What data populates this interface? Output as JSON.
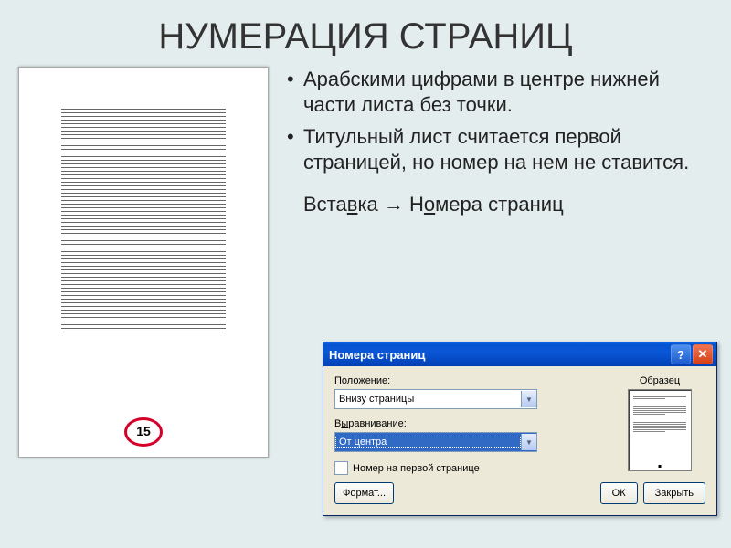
{
  "title": "НУМЕРАЦИЯ СТРАНИЦ",
  "bullets": [
    "Арабскими цифрами в центре нижней части листа без точки.",
    "Титульный лист считается первой страницей, но номер на нем не ставится."
  ],
  "menu_path": {
    "part1": "Вста",
    "u1": "в",
    "part2": "ка",
    "arrow": "→",
    "part3": "Н",
    "u2": "о",
    "part4": "мера страниц"
  },
  "page_sample": {
    "number": "15"
  },
  "dialog": {
    "title": "Номера страниц",
    "position_label_pre": "П",
    "position_label_u": "о",
    "position_label_post": "ложение:",
    "position_value": "Внизу страницы",
    "align_label_pre": "В",
    "align_label_u": "ы",
    "align_label_post": "равнивание:",
    "align_value": "От центра",
    "sample_label_pre": "Образе",
    "sample_label_u": "ц",
    "checkbox_pre": "",
    "checkbox_u": "Н",
    "checkbox_post": "омер на первой странице",
    "format_btn_u": "Ф",
    "format_btn_post": "ормат...",
    "ok": "ОК",
    "cancel": "Закрыть"
  }
}
